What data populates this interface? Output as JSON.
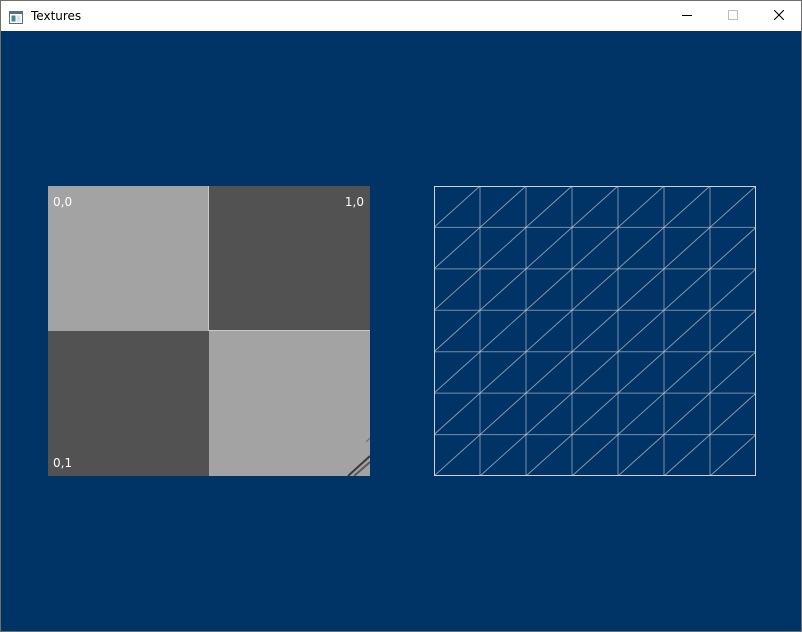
{
  "window": {
    "title": "Textures",
    "title_icon": "application-window-icon",
    "controls": {
      "minimize": "minimize-icon",
      "maximize": "maximize-icon",
      "close": "close-icon"
    }
  },
  "scene": {
    "background_color": "#003366",
    "textured_quad": {
      "colors": {
        "light": "#a3a3a3",
        "dark": "#525252",
        "divider": "#c8c8c8"
      },
      "uv_labels": {
        "top_left": "0,0",
        "top_right": "1,0",
        "bottom_left": "0,1"
      }
    },
    "wireframe_quad": {
      "line_color": "#d9d9d9",
      "grid_columns": 7,
      "grid_rows": 7
    }
  }
}
